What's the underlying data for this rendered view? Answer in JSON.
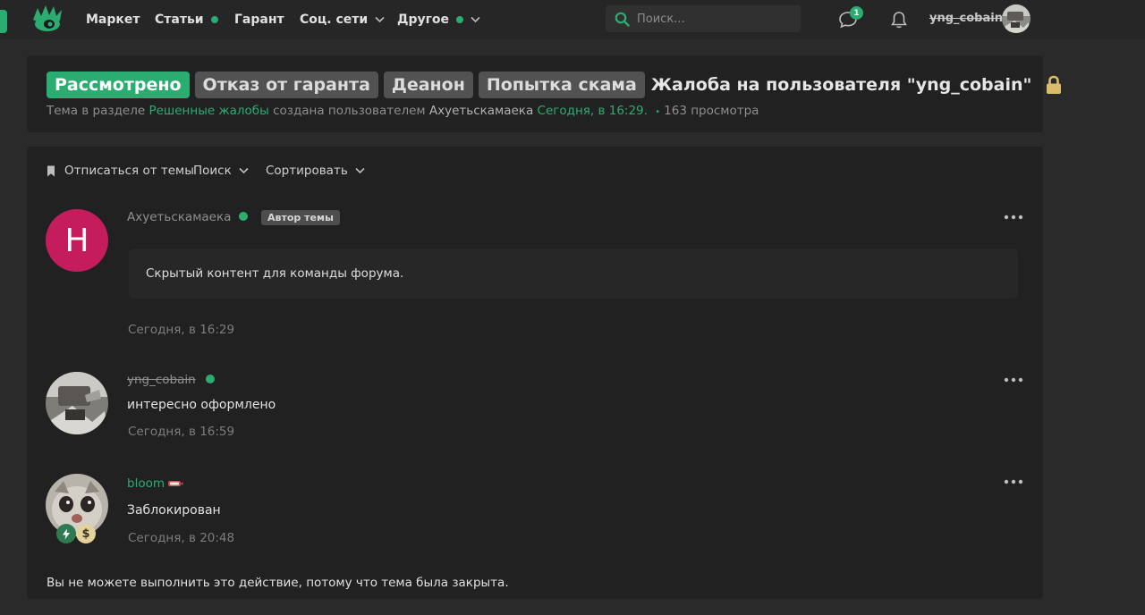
{
  "nav": {
    "items": [
      {
        "label": "Маркет"
      },
      {
        "label": "Статьи"
      },
      {
        "label": "Гарант"
      },
      {
        "label": "Соц. сети"
      },
      {
        "label": "Другое"
      }
    ],
    "search_placeholder": "Поиск...",
    "messages_badge": "1",
    "username": "yng_cobain"
  },
  "thread": {
    "prefixes": [
      "Рассмотрено",
      "Отказ от гаранта",
      "Деанон",
      "Попытка скама"
    ],
    "title": "Жалоба на пользователя \"yng_cobain\"",
    "meta": {
      "before_section": "Тема в разделе",
      "section": "Решенные жалобы",
      "created_by": "создана пользователем",
      "author": "Ахуетьскамаека",
      "date": "Сегодня, в 16:29.",
      "views": "163 просмотра"
    }
  },
  "toolbar": {
    "unsubscribe": "Отписаться от темы",
    "search": "Поиск",
    "sort": "Сортировать"
  },
  "posts": [
    {
      "avatar_letter": "Н",
      "username": "Ахуетьскамаека",
      "badge": "Автор темы",
      "content": "Скрытый контент для команды форума.",
      "date": "Сегодня, в 16:29"
    },
    {
      "username": "yng_cobain",
      "content": "интересно оформлено",
      "date": "Сегодня, в 16:59"
    },
    {
      "username": "bloom",
      "content": "Заблокирован",
      "date": "Сегодня, в 20:48",
      "mini_badge_2": "$"
    }
  ],
  "closed_note": "Вы не можете выполнить это действие, потому что тема была закрыта.",
  "colors": {
    "accent": "#2bad72",
    "page_bg": "#2a2a2a",
    "panel_bg": "#212121",
    "avatar_letter_bg": "#c41c5c",
    "prefix_gray": "#525252"
  },
  "icons": [
    "logo-icon",
    "search-icon",
    "messages-icon",
    "bell-icon",
    "lock-icon",
    "bookmark-icon",
    "chevron-down-icon",
    "more-dots-icon",
    "bolt-icon",
    "dollar-icon"
  ]
}
